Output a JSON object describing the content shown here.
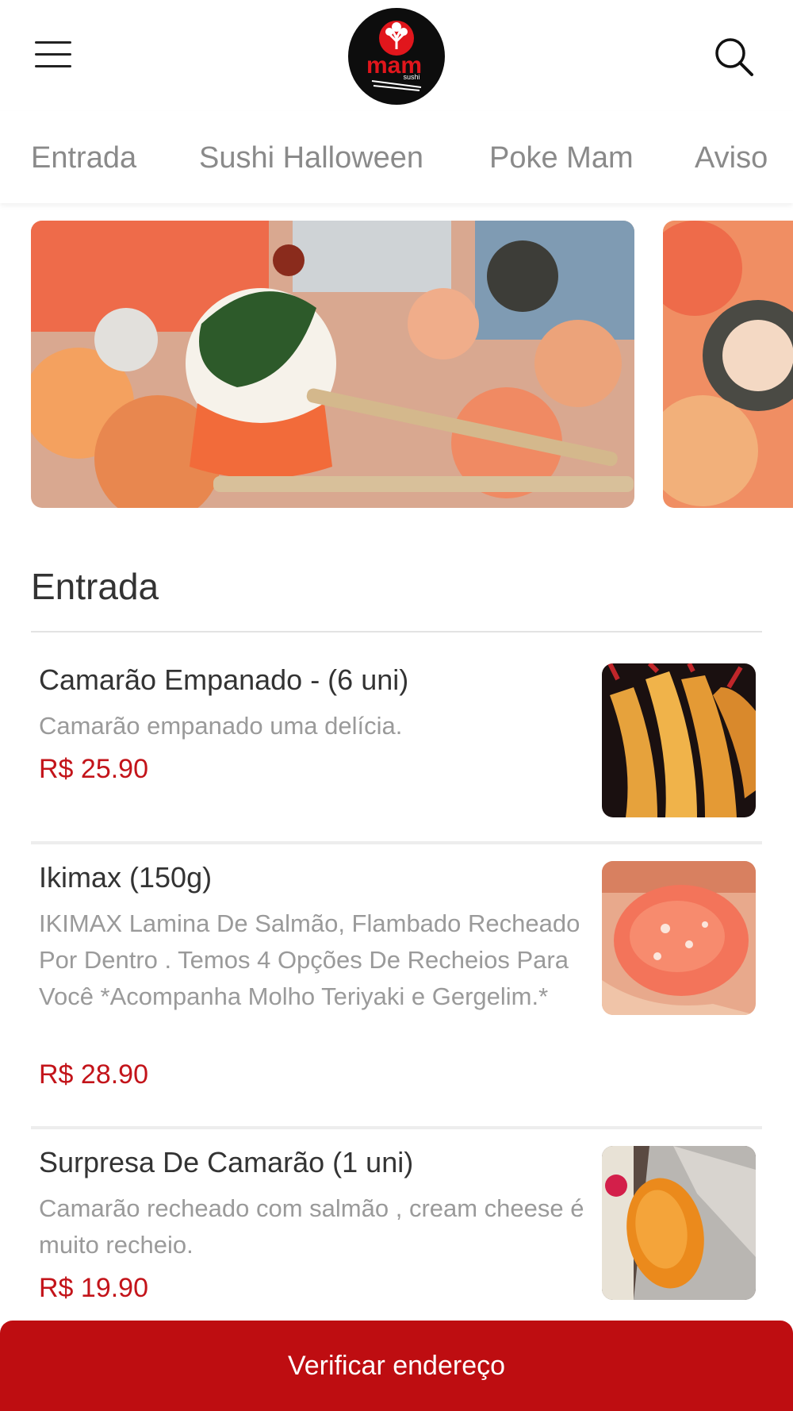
{
  "brand": {
    "logo_text": "mam",
    "logo_subtext": "sushi",
    "colors": {
      "accent": "#be0d11",
      "price": "#c3141a",
      "logo_bg": "#0d0d0d"
    }
  },
  "header": {
    "menu_icon": "hamburger-icon",
    "search_icon": "search-icon"
  },
  "tabs": [
    {
      "label": "Entrada"
    },
    {
      "label": "Sushi Halloween"
    },
    {
      "label": "Poke Mam"
    },
    {
      "label": "Aviso"
    }
  ],
  "section": {
    "title": "Entrada"
  },
  "items": [
    {
      "name": "Camarão Empanado - (6 uni)",
      "description": "Camarão empanado uma delícia.",
      "price": "R$ 25.90"
    },
    {
      "name": "Ikimax (150g)",
      "description": "IKIMAX Lamina De Salmão, Flambado Recheado Por Dentro . Temos 4 Opções De Recheios Para Você *Acompanha Molho Teriyaki e Gergelim.*",
      "price": "R$ 28.90"
    },
    {
      "name": "Surpresa De Camarão (1 uni)",
      "description": "Camarão recheado com salmão , cream cheese é muito recheio.",
      "price": "R$ 19.90"
    }
  ],
  "cta": {
    "label": "Verificar endereço"
  }
}
